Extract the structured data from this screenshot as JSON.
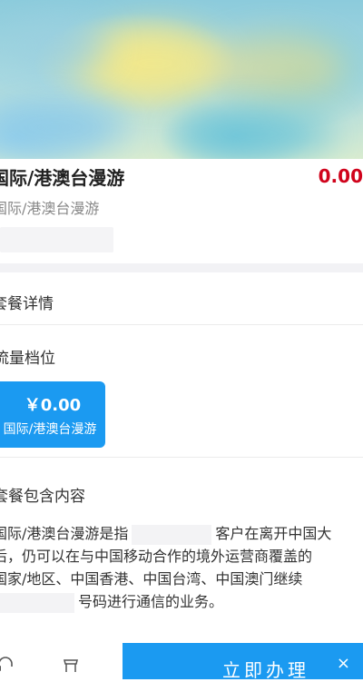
{
  "product": {
    "title": "国际/港澳台漫游",
    "price": "0.00",
    "subtitle": "国际/港澳台漫游"
  },
  "sections": {
    "details": "套餐详情",
    "tier": "流量档位",
    "contents": "套餐包含内容"
  },
  "option": {
    "price": "￥0.00",
    "name": "国际/港澳台漫游"
  },
  "description": {
    "line1_a": "国际/港澳台漫游是指",
    "line1_b": "客户在离开中国大",
    "line2": "后，仍可以在与中国移动合作的境外运营商覆盖的",
    "line3": "国家/地区、中国香港、中国台湾、中国澳门继续",
    "line4_b": "号码进行通信的业务。"
  },
  "cta": {
    "label": "立即办理",
    "close": "×"
  },
  "colors": {
    "accent": "#1b9af1",
    "price": "#d0021b"
  }
}
